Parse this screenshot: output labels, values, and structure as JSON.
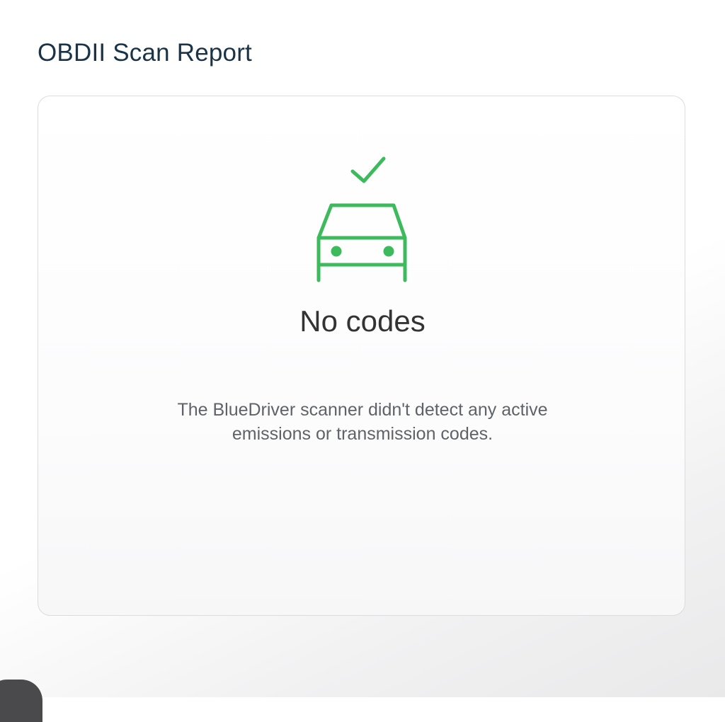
{
  "header": {
    "title": "OBDII Scan Report"
  },
  "report": {
    "status_icon": "car-check-icon",
    "accent_color": "#3cba5c",
    "heading": "No codes",
    "message": "The BlueDriver scanner didn't detect any active emissions or transmission codes."
  }
}
